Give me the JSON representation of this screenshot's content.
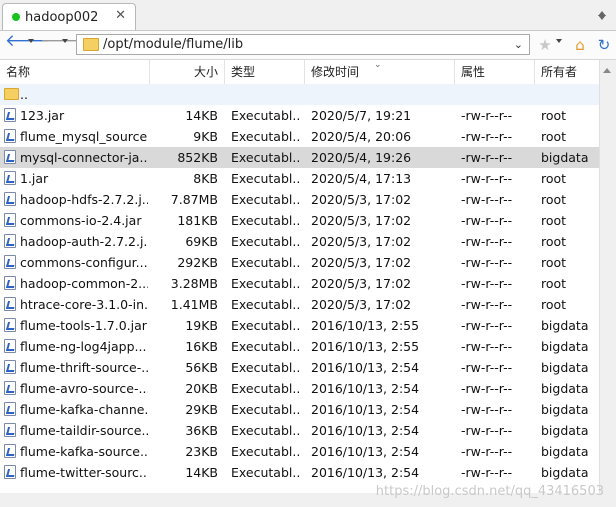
{
  "tab": {
    "title": "hadoop002",
    "close": "✕"
  },
  "toolbar": {
    "path": "/opt/module/flume/lib",
    "back": "🡐",
    "forward": "🡒"
  },
  "columns": [
    "名称",
    "大小",
    "类型",
    "修改时间",
    "属性",
    "所有者"
  ],
  "parent_row": {
    "name": ".."
  },
  "rows": [
    {
      "name": "123.jar",
      "size": "14KB",
      "type": "Executabl...",
      "time": "2020/5/7, 19:21",
      "attr": "-rw-r--r--",
      "owner": "root"
    },
    {
      "name": "flume_mysql_source...",
      "size": "9KB",
      "type": "Executabl...",
      "time": "2020/5/4, 20:06",
      "attr": "-rw-r--r--",
      "owner": "root"
    },
    {
      "name": "mysql-connector-ja...",
      "size": "852KB",
      "type": "Executabl...",
      "time": "2020/5/4, 19:26",
      "attr": "-rw-r--r--",
      "owner": "bigdata"
    },
    {
      "name": "1.jar",
      "size": "8KB",
      "type": "Executabl...",
      "time": "2020/5/4, 17:13",
      "attr": "-rw-r--r--",
      "owner": "root"
    },
    {
      "name": "hadoop-hdfs-2.7.2.j...",
      "size": "7.87MB",
      "type": "Executabl...",
      "time": "2020/5/3, 17:02",
      "attr": "-rw-r--r--",
      "owner": "root"
    },
    {
      "name": "commons-io-2.4.jar",
      "size": "181KB",
      "type": "Executabl...",
      "time": "2020/5/3, 17:02",
      "attr": "-rw-r--r--",
      "owner": "root"
    },
    {
      "name": "hadoop-auth-2.7.2.j...",
      "size": "69KB",
      "type": "Executabl...",
      "time": "2020/5/3, 17:02",
      "attr": "-rw-r--r--",
      "owner": "root"
    },
    {
      "name": "commons-configur...",
      "size": "292KB",
      "type": "Executabl...",
      "time": "2020/5/3, 17:02",
      "attr": "-rw-r--r--",
      "owner": "root"
    },
    {
      "name": "hadoop-common-2...",
      "size": "3.28MB",
      "type": "Executabl...",
      "time": "2020/5/3, 17:02",
      "attr": "-rw-r--r--",
      "owner": "root"
    },
    {
      "name": "htrace-core-3.1.0-in...",
      "size": "1.41MB",
      "type": "Executabl...",
      "time": "2020/5/3, 17:02",
      "attr": "-rw-r--r--",
      "owner": "root"
    },
    {
      "name": "flume-tools-1.7.0.jar",
      "size": "19KB",
      "type": "Executabl...",
      "time": "2016/10/13, 2:55",
      "attr": "-rw-r--r--",
      "owner": "bigdata"
    },
    {
      "name": "flume-ng-log4japp...",
      "size": "16KB",
      "type": "Executabl...",
      "time": "2016/10/13, 2:55",
      "attr": "-rw-r--r--",
      "owner": "bigdata"
    },
    {
      "name": "flume-thrift-source-...",
      "size": "56KB",
      "type": "Executabl...",
      "time": "2016/10/13, 2:54",
      "attr": "-rw-r--r--",
      "owner": "bigdata"
    },
    {
      "name": "flume-avro-source-...",
      "size": "20KB",
      "type": "Executabl...",
      "time": "2016/10/13, 2:54",
      "attr": "-rw-r--r--",
      "owner": "bigdata"
    },
    {
      "name": "flume-kafka-channe...",
      "size": "29KB",
      "type": "Executabl...",
      "time": "2016/10/13, 2:54",
      "attr": "-rw-r--r--",
      "owner": "bigdata"
    },
    {
      "name": "flume-taildir-source...",
      "size": "36KB",
      "type": "Executabl...",
      "time": "2016/10/13, 2:54",
      "attr": "-rw-r--r--",
      "owner": "bigdata"
    },
    {
      "name": "flume-kafka-source...",
      "size": "23KB",
      "type": "Executabl...",
      "time": "2016/10/13, 2:54",
      "attr": "-rw-r--r--",
      "owner": "bigdata"
    },
    {
      "name": "flume-twitter-sourc...",
      "size": "14KB",
      "type": "Executabl...",
      "time": "2016/10/13, 2:54",
      "attr": "-rw-r--r--",
      "owner": "bigdata"
    }
  ],
  "selected_row": 2,
  "watermark": "https://blog.csdn.net/qq_43416503",
  "colors": {
    "tab_dot": "#16c21c",
    "selected": "#d9d9d9",
    "folder": "#f5cf62"
  }
}
